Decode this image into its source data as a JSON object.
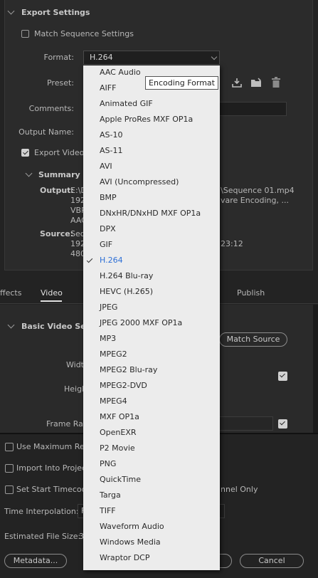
{
  "export_settings": {
    "title": "Export Settings",
    "match_sequence": "Match Sequence Settings",
    "format_label": "Format:",
    "format_value": "H.264",
    "preset_label": "Preset:",
    "comments_label": "Comments:",
    "output_name_label": "Output Name:",
    "export_video": "Export Video"
  },
  "summary": {
    "title": "Summary",
    "output_label": "Output:",
    "output_lines": [
      "E:\\D",
      "192",
      "VBR",
      "AAC"
    ],
    "output_right": [
      "\\Sequence 01.mp4",
      "vare Encoding, ..."
    ],
    "source_label": "Source:",
    "source_lines": [
      "Seq",
      "192",
      "480"
    ],
    "source_right": "23:12"
  },
  "tabs": [
    "ffects",
    "Video",
    "Publish"
  ],
  "video": {
    "section_title": "Basic Video Settin",
    "match_source": "Match Source",
    "width_label": "Widt",
    "height_label": "Heigh",
    "frame_rate_label": "Frame Rat"
  },
  "bottom": {
    "use_max_render": "Use Maximum Ren",
    "import_into_project": "Import Into Project",
    "set_start_timecode": "Set Start Timecode",
    "channel_only": "nnel Only",
    "time_interpolation": "Time Interpolation:",
    "time_interp_value": "F",
    "estimated_size": "Estimated File Size:",
    "estimated_size_value": "3",
    "metadata": "Metadata...",
    "cancel": "Cancel"
  },
  "tooltip": "Encoding Format",
  "format_options": [
    "AAC Audio",
    "AIFF",
    "Animated GIF",
    "Apple ProRes MXF OP1a",
    "AS-10",
    "AS-11",
    "AVI",
    "AVI (Uncompressed)",
    "BMP",
    "DNxHR/DNxHD MXF OP1a",
    "DPX",
    "GIF",
    "H.264",
    "H.264 Blu-ray",
    "HEVC (H.265)",
    "JPEG",
    "JPEG 2000 MXF OP1a",
    "MP3",
    "MPEG2",
    "MPEG2 Blu-ray",
    "MPEG2-DVD",
    "MPEG4",
    "MXF OP1a",
    "OpenEXR",
    "P2 Movie",
    "PNG",
    "QuickTime",
    "Targa",
    "TIFF",
    "Waveform Audio",
    "Windows Media",
    "Wraptor DCP"
  ],
  "selected_format": "H.264"
}
